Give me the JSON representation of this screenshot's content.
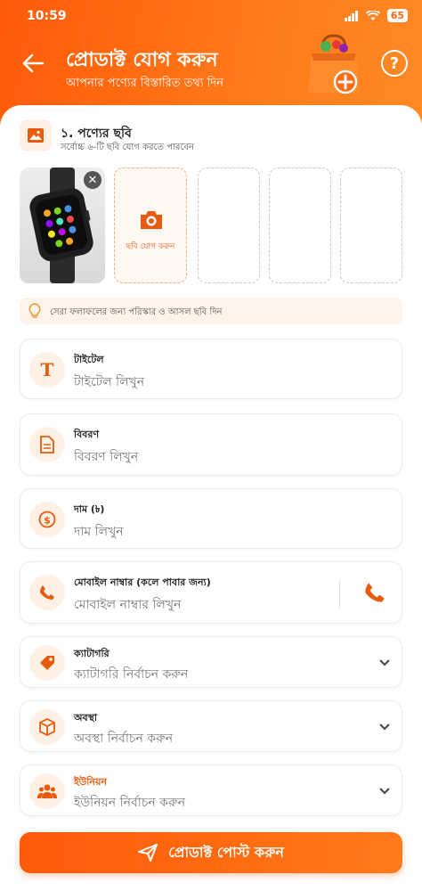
{
  "status": {
    "time": "10:59",
    "battery": "65"
  },
  "header": {
    "title": "প্রোডাক্ট যোগ করুন",
    "subtitle": "আপনার পণ্যের বিস্তারিত তথ্য দিন"
  },
  "photos": {
    "title": "১. পণ্যের ছবি",
    "subtitle": "সর্বোচ্চ ৬-টি ছবি যোগ করতে পারবেন",
    "add_label": "ছবি যোগ করুন",
    "tip": "সেরা ফলাফলের জন্য পরিস্কার ও আসল ছবি দিন"
  },
  "fields": {
    "title": {
      "label": "টাইটেল",
      "placeholder": "টাইটেল লিখুন"
    },
    "description": {
      "label": "বিবরণ",
      "placeholder": "বিবরণ লিখুন"
    },
    "price": {
      "label": "দাম (৳)",
      "placeholder": "দাম লিখুন"
    },
    "mobile": {
      "label": "মোবাইল নাম্বার (কলে পাবার জন্য)",
      "placeholder": "মোবাইল নাম্বার লিখুন"
    },
    "category": {
      "label": "ক্যাটাগরি",
      "placeholder": "ক্যাটাগরি নির্বাচন করুন"
    },
    "condition": {
      "label": "অবস্থা",
      "placeholder": "অবস্থা নির্বাচন করুন"
    },
    "union": {
      "label": "ইউনিয়ন",
      "placeholder": "ইউনিয়ন নির্বাচন করুন"
    }
  },
  "submit_label": "প্রোডাক্ট পোস্ট করুন",
  "colors": {
    "accent": "#ff6a10",
    "accent_dark": "#e85a0c",
    "icon_bg": "#fff1e6"
  }
}
